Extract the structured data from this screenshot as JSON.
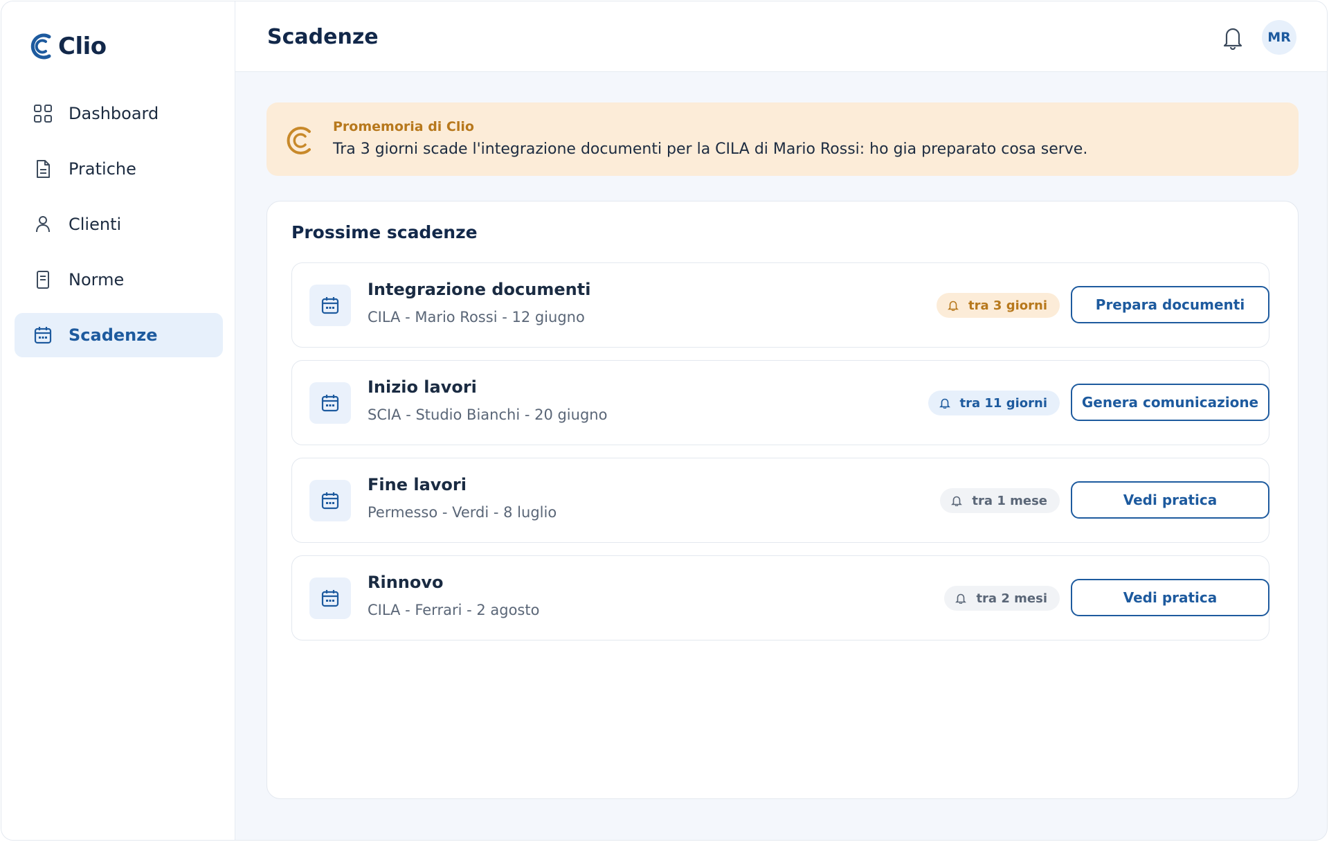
{
  "app": {
    "name": "Clio"
  },
  "sidebar": {
    "items": [
      {
        "label": "Dashboard",
        "icon": "grid-icon",
        "active": false
      },
      {
        "label": "Pratiche",
        "icon": "document-icon",
        "active": false
      },
      {
        "label": "Clienti",
        "icon": "user-icon",
        "active": false
      },
      {
        "label": "Norme",
        "icon": "book-icon",
        "active": false
      },
      {
        "label": "Scadenze",
        "icon": "calendar-icon",
        "active": true
      }
    ]
  },
  "header": {
    "title": "Scadenze",
    "avatar_initials": "MR",
    "bell_icon": "bell-icon"
  },
  "reminder": {
    "title": "Promemoria di Clio",
    "text": "Tra 3 giorni scade l'integrazione documenti per la CILA di Mario Rossi: ho gia preparato cosa serve."
  },
  "deadlines": {
    "title": "Prossime scadenze",
    "items": [
      {
        "title": "Integrazione documenti",
        "subtitle": "CILA - Mario Rossi - 12 giugno",
        "badge": "tra 3 giorni",
        "badge_style": "warn",
        "action": "Prepara documenti"
      },
      {
        "title": "Inizio lavori",
        "subtitle": "SCIA - Studio Bianchi - 20 giugno",
        "badge": "tra 11 giorni",
        "badge_style": "info",
        "action": "Genera comunicazione"
      },
      {
        "title": "Fine lavori",
        "subtitle": "Permesso - Verdi - 8 luglio",
        "badge": "tra 1 mese",
        "badge_style": "neutral",
        "action": "Vedi pratica"
      },
      {
        "title": "Rinnovo",
        "subtitle": "CILA - Ferrari - 2 agosto",
        "badge": "tra 2 mesi",
        "badge_style": "neutral",
        "action": "Vedi pratica"
      }
    ]
  },
  "colors": {
    "primary": "#1d5a9e",
    "navy": "#12284a",
    "warn_bg": "#fcecd8",
    "warn_text": "#b7781c"
  }
}
